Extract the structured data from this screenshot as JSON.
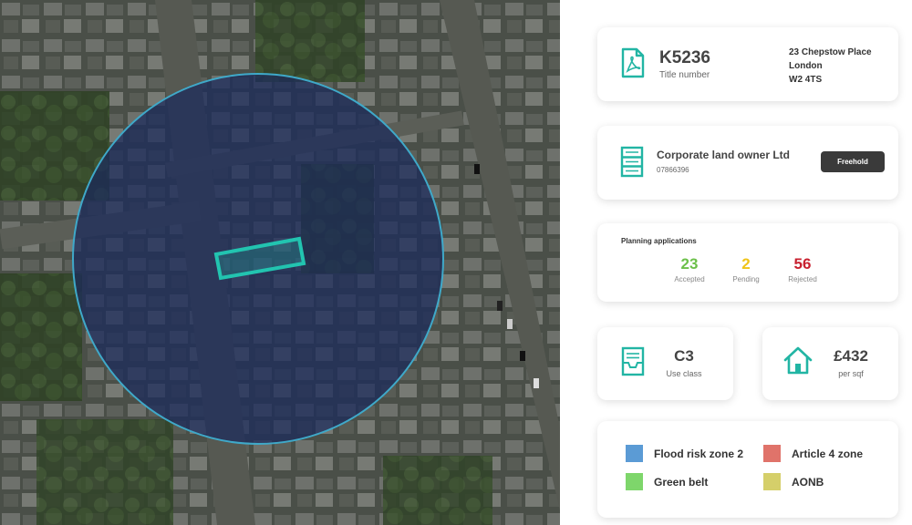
{
  "map": {
    "radius_color": "#1a2a5c",
    "radius_stroke": "#3fa9c9",
    "plot_outline": "#22c4b0"
  },
  "title_card": {
    "icon": "pdf-document-icon",
    "title_number": "K5236",
    "title_label": "Title number",
    "address_line1": "23 Chepstow Place",
    "address_line2": "London",
    "address_line3": "W2 4TS"
  },
  "owner_card": {
    "icon": "server-stack-icon",
    "owner_name": "Corporate land owner Ltd",
    "company_number": "07866396",
    "tenure_label": "Freehold"
  },
  "planning_card": {
    "heading": "Planning applications",
    "stats": [
      {
        "value": "23",
        "label": "Accepted",
        "color": "#6cc04a"
      },
      {
        "value": "2",
        "label": "Pending",
        "color": "#f0c419"
      },
      {
        "value": "56",
        "label": "Rejected",
        "color": "#c8202f"
      }
    ]
  },
  "use_card": {
    "icon": "inbox-tray-icon",
    "value": "C3",
    "label": "Use class"
  },
  "price_card": {
    "icon": "house-icon",
    "value": "£432",
    "label": "per sqf"
  },
  "constraints_card": {
    "items": [
      {
        "label": "Flood risk zone 2",
        "color": "#5b9bd5"
      },
      {
        "label": "Article 4 zone",
        "color": "#e0736a"
      },
      {
        "label": "Green belt",
        "color": "#7ed66b"
      },
      {
        "label": "AONB",
        "color": "#d5cf6a"
      }
    ]
  }
}
